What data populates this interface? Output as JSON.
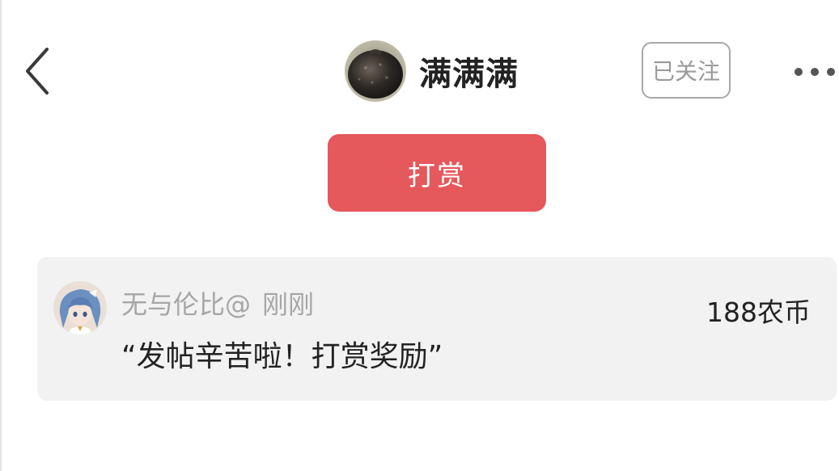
{
  "header": {
    "author_name": "满满满",
    "follow_label": "已关注"
  },
  "reward_button": {
    "label": "打赏"
  },
  "rewards": [
    {
      "username": "无与伦比@",
      "time": "刚刚",
      "message": "“发帖辛苦啦！打赏奖励”",
      "amount": "188农币"
    }
  ],
  "icons": {
    "back": "chevron-left-icon",
    "more": "more-dots-icon"
  },
  "colors": {
    "accent": "#e5585b",
    "card_bg": "#f2f2f2",
    "muted_text": "#a6a6a6",
    "primary_text": "#222222"
  }
}
